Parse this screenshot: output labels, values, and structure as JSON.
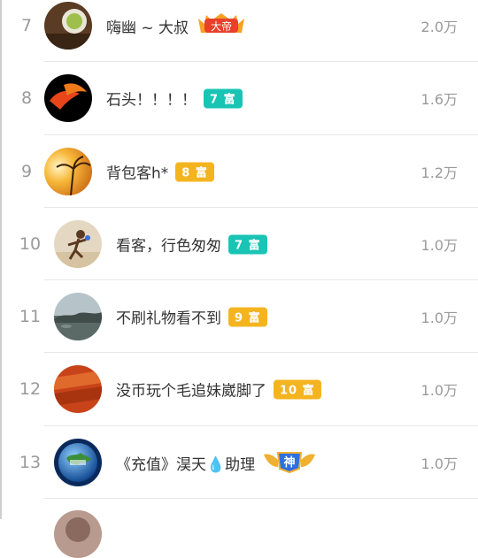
{
  "rows": [
    {
      "rank": "7",
      "name": "嗨幽 ~ 大叔",
      "badge": "大帝",
      "amount": "2.0万"
    },
    {
      "rank": "8",
      "name": "石头！！！！",
      "badge": "7 富",
      "amount": "1.6万"
    },
    {
      "rank": "9",
      "name": "背包客h*",
      "badge": "8 富",
      "amount": "1.2万"
    },
    {
      "rank": "10",
      "name": "看客，行色匆匆",
      "badge": "7 富",
      "amount": "1.0万"
    },
    {
      "rank": "11",
      "name": "不刷礼物看不到",
      "badge": "9 富",
      "amount": "1.0万"
    },
    {
      "rank": "12",
      "name": "没币玩个毛追妹崴脚了",
      "badge": "10 富",
      "amount": "1.0万"
    },
    {
      "rank": "13",
      "name": "《充值》淏天💧助理",
      "badge": "神",
      "amount": "1.0万"
    }
  ],
  "colors": {
    "teal": "#19c4b4",
    "gold": "#f4b420",
    "divider": "#e6e6e6",
    "muted": "#9a9a9a"
  }
}
